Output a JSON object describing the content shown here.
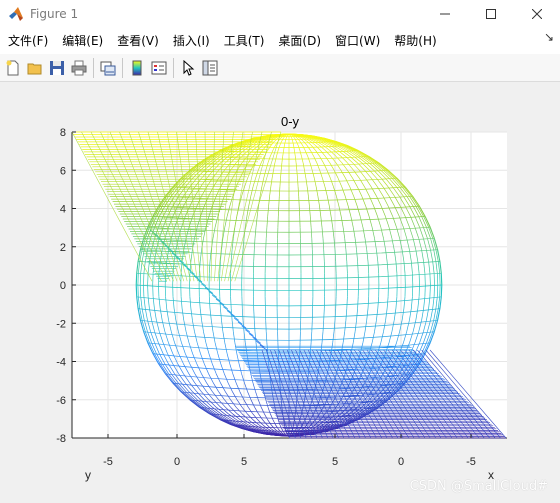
{
  "window": {
    "title": "Figure 1",
    "controls": {
      "minimize": "—",
      "maximize": "☐",
      "close": "✕"
    }
  },
  "menu": {
    "items": [
      "文件(F)",
      "编辑(E)",
      "查看(V)",
      "插入(I)",
      "工具(T)",
      "桌面(D)",
      "窗口(W)",
      "帮助(H)"
    ],
    "overflow_arrow": "↘"
  },
  "toolbar": {
    "buttons": [
      "new-figure-icon",
      "open-file-icon",
      "save-icon",
      "print-icon",
      "link-plot-icon",
      "colorbar-icon",
      "legend-icon",
      "pointer-icon",
      "property-inspector-icon"
    ]
  },
  "chart_data": {
    "type": "mesh surface (3D view)",
    "title": "0-y",
    "xlabel": "x",
    "ylabel": "y",
    "x_axis_ticks": [
      "-5",
      "0",
      "5",
      "5",
      "0",
      "-5"
    ],
    "z_axis_ticks": [
      "8",
      "6",
      "4",
      "2",
      "0",
      "-2",
      "-4",
      "-6",
      "-8"
    ],
    "zlim": [
      -8,
      8
    ],
    "grid": true,
    "colormap": [
      "#3e26a8",
      "#2f8ef9",
      "#23c6c0",
      "#8dcd3e",
      "#f9fb15"
    ],
    "surfaces": [
      {
        "name": "sphere",
        "center": [
          0,
          0,
          0
        ],
        "radius": 8
      },
      {
        "name": "plane",
        "description_value": "slanted mesh plane"
      }
    ]
  },
  "watermark": "CSDN @SmallCloud#"
}
